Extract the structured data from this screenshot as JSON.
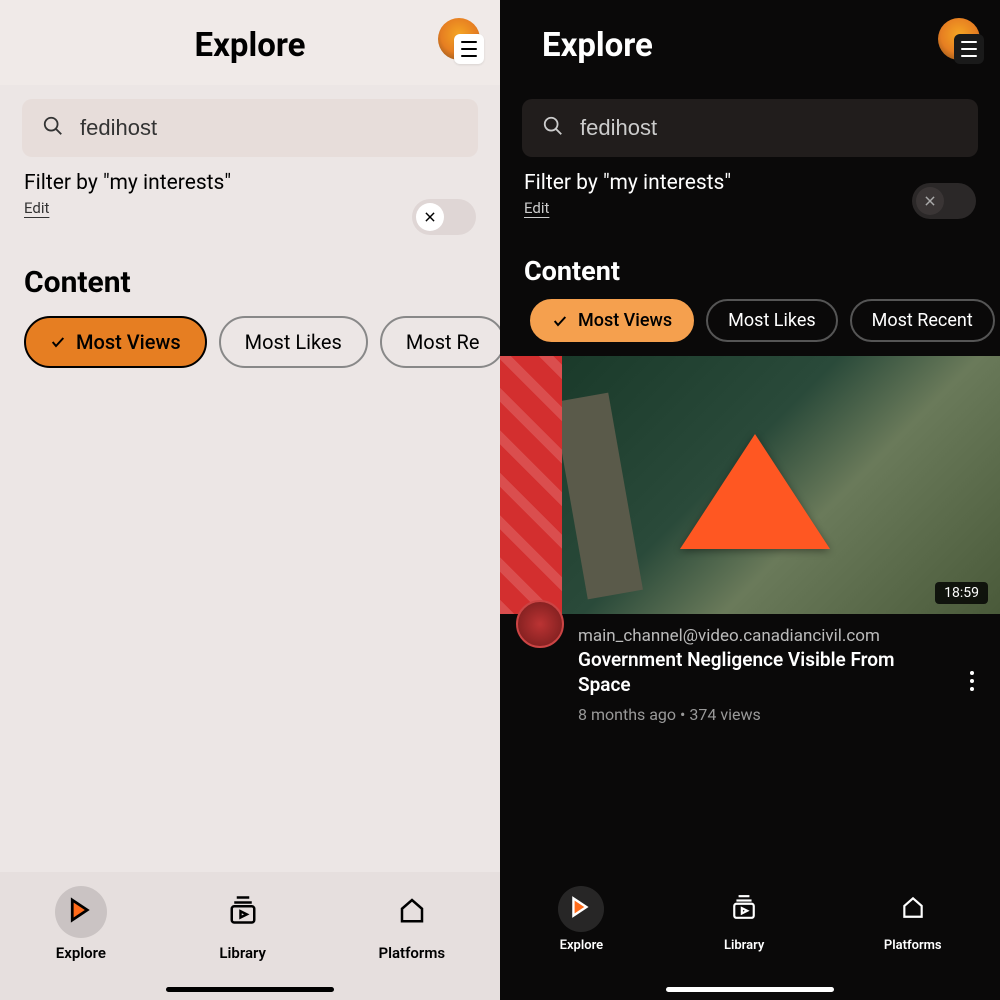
{
  "header": {
    "title": "Explore"
  },
  "search": {
    "value": "fedihost"
  },
  "filter": {
    "label": "Filter by \"my interests\"",
    "edit": "Edit"
  },
  "content": {
    "heading": "Content"
  },
  "chips": {
    "most_views": "Most Views",
    "most_likes": "Most Likes",
    "most_recent_full": "Most Recent",
    "most_recent_trunc": "Most Re"
  },
  "video": {
    "channel": "main_channel@video.canadiancivil.com",
    "title": "Government Negligence Visible From Space",
    "stats": "8 months ago • 374 views",
    "duration": "18:59"
  },
  "nav": {
    "explore": "Explore",
    "library": "Library",
    "platforms": "Platforms"
  }
}
